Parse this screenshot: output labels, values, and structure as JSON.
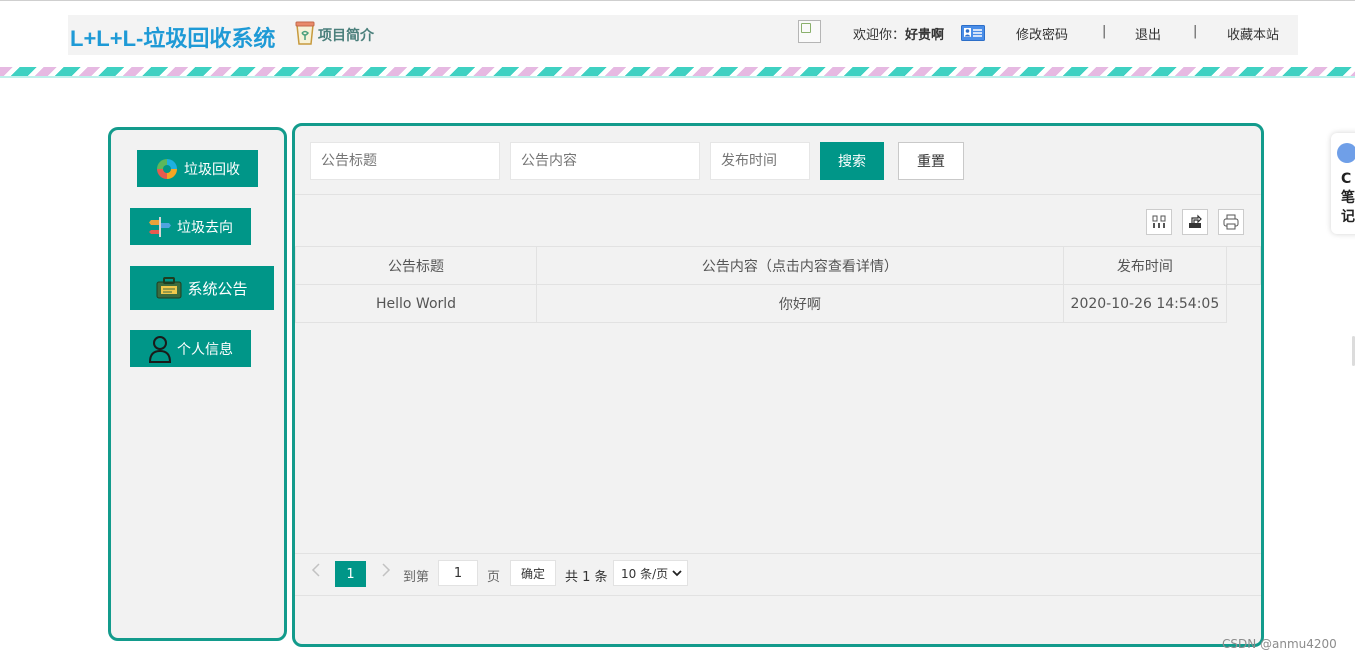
{
  "header": {
    "brand": "L+L+L-垃圾回收系统",
    "intro_label": "项目简介",
    "welcome_prefix": "欢迎你：",
    "username": "好贵啊",
    "change_password": "修改密码",
    "separator": "|",
    "logout": "退出",
    "bookmark": "收藏本站"
  },
  "sidebar": {
    "items": [
      {
        "label": "垃圾回收"
      },
      {
        "label": "垃圾去向"
      },
      {
        "label": "系统公告"
      },
      {
        "label": "个人信息"
      }
    ]
  },
  "search": {
    "title_placeholder": "公告标题",
    "content_placeholder": "公告内容",
    "time_placeholder": "发布时间",
    "search_label": "搜索",
    "reset_label": "重置"
  },
  "toolbar": {
    "icons": [
      "columns-filter-icon",
      "export-icon",
      "print-icon"
    ]
  },
  "table": {
    "columns": [
      "公告标题",
      "公告内容（点击内容查看详情）",
      "发布时间"
    ],
    "rows": [
      [
        "Hello World",
        "你好啊",
        "2020-10-26 14:54:05"
      ]
    ]
  },
  "pagination": {
    "current_page": "1",
    "goto_prefix": "到第",
    "goto_value": "1",
    "goto_suffix": "页",
    "confirm_label": "确定",
    "total_text": "共 1 条",
    "page_size": "10 条/页"
  },
  "float_widget": {
    "text": "C笔记"
  },
  "watermark": "CSDN @anmu4200",
  "colors": {
    "brand": "#1e9ad6",
    "accent": "#009688",
    "border": "#139b8c"
  }
}
